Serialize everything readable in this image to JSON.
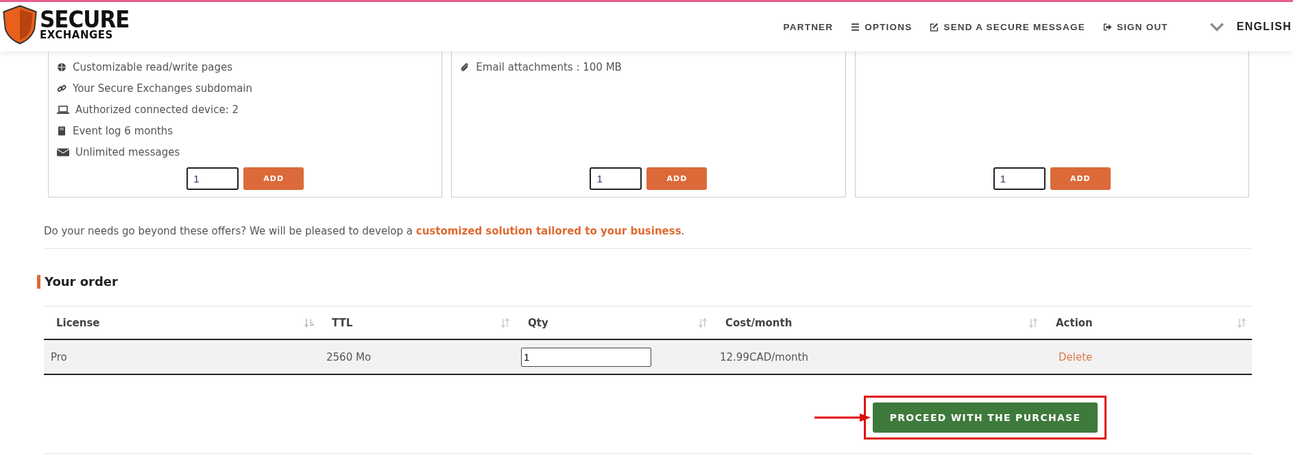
{
  "header": {
    "logo": {
      "line_1": "SECURE",
      "line_2": "EXCHANGES"
    },
    "nav": [
      {
        "label": "PARTNER",
        "kind": "plain"
      },
      {
        "label": "OPTIONS",
        "kind": "menu"
      },
      {
        "label": "SEND A SECURE MESSAGE",
        "kind": "compose"
      },
      {
        "label": "SIGN OUT",
        "kind": "signout"
      }
    ],
    "language": "ENGLISH"
  },
  "cards": [
    {
      "features": [
        {
          "kind": "globe",
          "text": "Customizable read/write pages"
        },
        {
          "kind": "link",
          "text": "Your Secure Exchanges subdomain"
        },
        {
          "kind": "laptop",
          "text": "Authorized connected device: 2"
        },
        {
          "kind": "book",
          "text": "Event log 6 months"
        },
        {
          "kind": "envelope",
          "text": "Unlimited messages"
        }
      ],
      "quantity": "1",
      "button": "ADD"
    },
    {
      "features": [
        {
          "kind": "paperclip",
          "text": "Email attachments : 100 MB"
        }
      ],
      "quantity": "1",
      "button": "ADD"
    },
    {
      "quantity": "1",
      "button": "ADD"
    }
  ],
  "note": {
    "text": "Do your needs go beyond these offers? We will be pleased to develop a ",
    "link": "customized solution tailored to your business",
    "end": "."
  },
  "order": {
    "title": "Your order",
    "columns": [
      {
        "label": "License",
        "sorted": true
      },
      {
        "label": "TTL",
        "sorted": false
      },
      {
        "label": "Qty",
        "sorted": false
      },
      {
        "label": "Cost/month",
        "sorted": false
      },
      {
        "label": "Action",
        "sorted": false
      }
    ],
    "rows": [
      {
        "license": "Pro",
        "ttl": "2560 Mo",
        "qty": "1",
        "cost": "12.99CAD/month",
        "action": "Delete"
      }
    ],
    "proceed_button": "PROCEED WITH THE PURCHASE"
  }
}
